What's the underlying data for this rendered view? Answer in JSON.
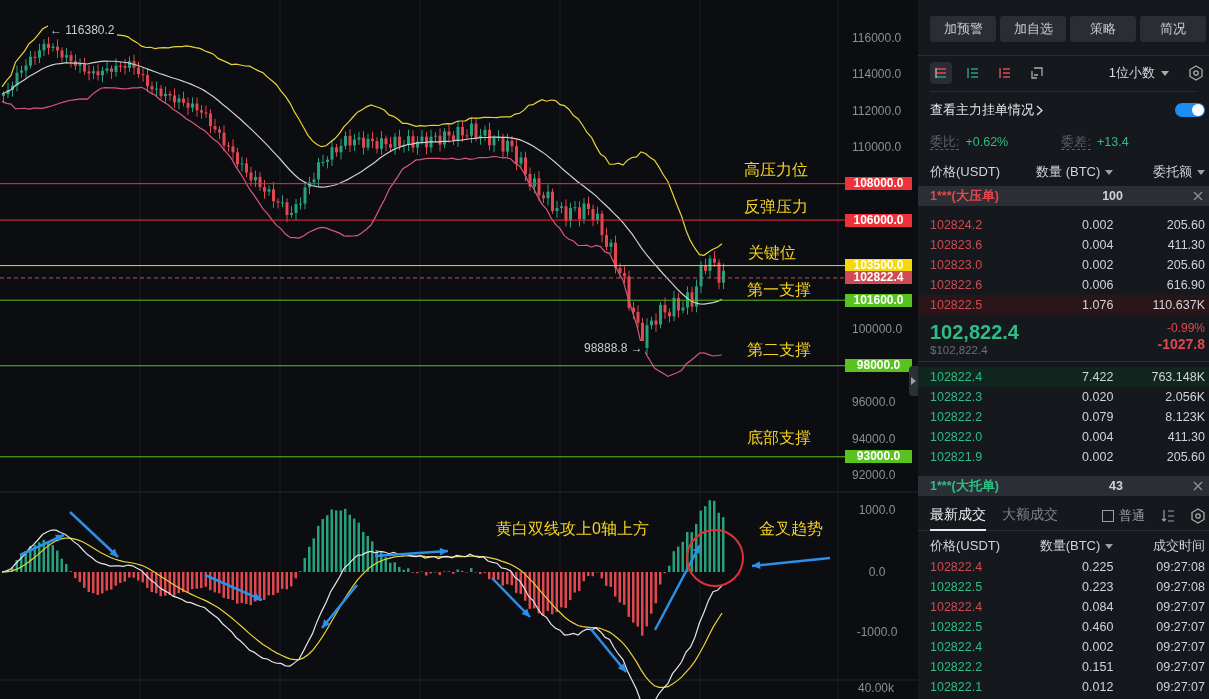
{
  "chart": {
    "price_axis": [
      "116000.0",
      "114000.0",
      "112000.0",
      "110000.0",
      "100000.0",
      "96000.0",
      "94000.0",
      "92000.0"
    ],
    "macd_axis": [
      "1000.0",
      "0.0",
      "-1000.0"
    ],
    "volume_axis": "40.00k",
    "levels": [
      {
        "label": "108000.0",
        "color": "#f0303a",
        "kind": "line"
      },
      {
        "label": "106000.0",
        "color": "#f0303a",
        "kind": "line"
      },
      {
        "label": "103500.0",
        "color": "#f5d90a",
        "kind": "line"
      },
      {
        "label": "102822.4",
        "color": "#cf4a52",
        "kind": "current"
      },
      {
        "label": "101600.0",
        "color": "#58c21e",
        "kind": "line"
      },
      {
        "label": "98000.0",
        "color": "#58c21e",
        "kind": "line"
      },
      {
        "label": "93000.0",
        "color": "#58c21e",
        "kind": "line"
      }
    ],
    "annotations": [
      {
        "text": "高压力位"
      },
      {
        "text": "反弹压力"
      },
      {
        "text": "关键位"
      },
      {
        "text": "第一支撑"
      },
      {
        "text": "第二支撑"
      },
      {
        "text": "底部支撑"
      },
      {
        "text": "黄白双线攻上0轴上方"
      },
      {
        "text": "金叉趋势"
      }
    ],
    "price_notes": [
      "← 116380.2",
      "98888.8 →"
    ]
  },
  "actions": [
    "加预警",
    "加自选",
    "策略",
    "简况"
  ],
  "view_modes": [
    {
      "kind": "both",
      "selected": true
    },
    {
      "kind": "bids",
      "selected": false
    },
    {
      "kind": "asks",
      "selected": false
    },
    {
      "kind": "custom",
      "selected": false
    }
  ],
  "precision": "1位小数",
  "main_orders": {
    "label": "查看主力挂单情况",
    "on": true
  },
  "stats": [
    {
      "label": "委比:",
      "value": "+0.62%"
    },
    {
      "label": "委差:",
      "value": "+13.4"
    }
  ],
  "book_columns": [
    "价格(USDT)",
    "数量 (BTC)",
    "委托额"
  ],
  "big_ask": {
    "label": "1***(大压单)",
    "qty": "100"
  },
  "asks": [
    {
      "price": "102824.2",
      "qty": "0.002",
      "total": "205.60",
      "highlighted": false
    },
    {
      "price": "102823.6",
      "qty": "0.004",
      "total": "411.30",
      "highlighted": false
    },
    {
      "price": "102823.0",
      "qty": "0.002",
      "total": "205.60",
      "highlighted": false
    },
    {
      "price": "102822.6",
      "qty": "0.006",
      "total": "616.90",
      "highlighted": false
    },
    {
      "price": "102822.5",
      "qty": "1.076",
      "total": "110.637K",
      "highlighted": true
    }
  ],
  "last": {
    "price": "102,822.4",
    "usd": "$102,822.4",
    "change_pct": "-0.99%",
    "change": "-1027.8"
  },
  "bids": [
    {
      "price": "102822.4",
      "qty": "7.422",
      "total": "763.148K",
      "highlighted": true
    },
    {
      "price": "102822.3",
      "qty": "0.020",
      "total": "2.056K",
      "highlighted": false
    },
    {
      "price": "102822.2",
      "qty": "0.079",
      "total": "8.123K",
      "highlighted": false
    },
    {
      "price": "102822.0",
      "qty": "0.004",
      "total": "411.30",
      "highlighted": false
    },
    {
      "price": "102821.9",
      "qty": "0.002",
      "total": "205.60",
      "highlighted": false
    }
  ],
  "big_bid": {
    "label": "1***(大托单)",
    "qty": "43"
  },
  "trade_tabs": [
    {
      "label": "最新成交",
      "selected": true
    },
    {
      "label": "大额成交",
      "selected": false
    }
  ],
  "normal_filter": {
    "label": "普通",
    "checked": false
  },
  "trade_columns": [
    "价格(USDT)",
    "数量(BTC)",
    "成交时间"
  ],
  "trades": [
    {
      "price": "102822.4",
      "qty": "0.225",
      "time": "09:27:08",
      "color": "#cf4a52"
    },
    {
      "price": "102822.5",
      "qty": "0.223",
      "time": "09:27:08",
      "color": "#2ebd85"
    },
    {
      "price": "102822.4",
      "qty": "0.084",
      "time": "09:27:07",
      "color": "#cf4a52"
    },
    {
      "price": "102822.5",
      "qty": "0.460",
      "time": "09:27:07",
      "color": "#2ebd85"
    },
    {
      "price": "102822.4",
      "qty": "0.002",
      "time": "09:27:07",
      "color": "#2ebd85"
    },
    {
      "price": "102822.2",
      "qty": "0.151",
      "time": "09:27:07",
      "color": "#2ebd85"
    },
    {
      "price": "102822.1",
      "qty": "0.012",
      "time": "09:27:07",
      "color": "#2ebd85"
    }
  ]
}
